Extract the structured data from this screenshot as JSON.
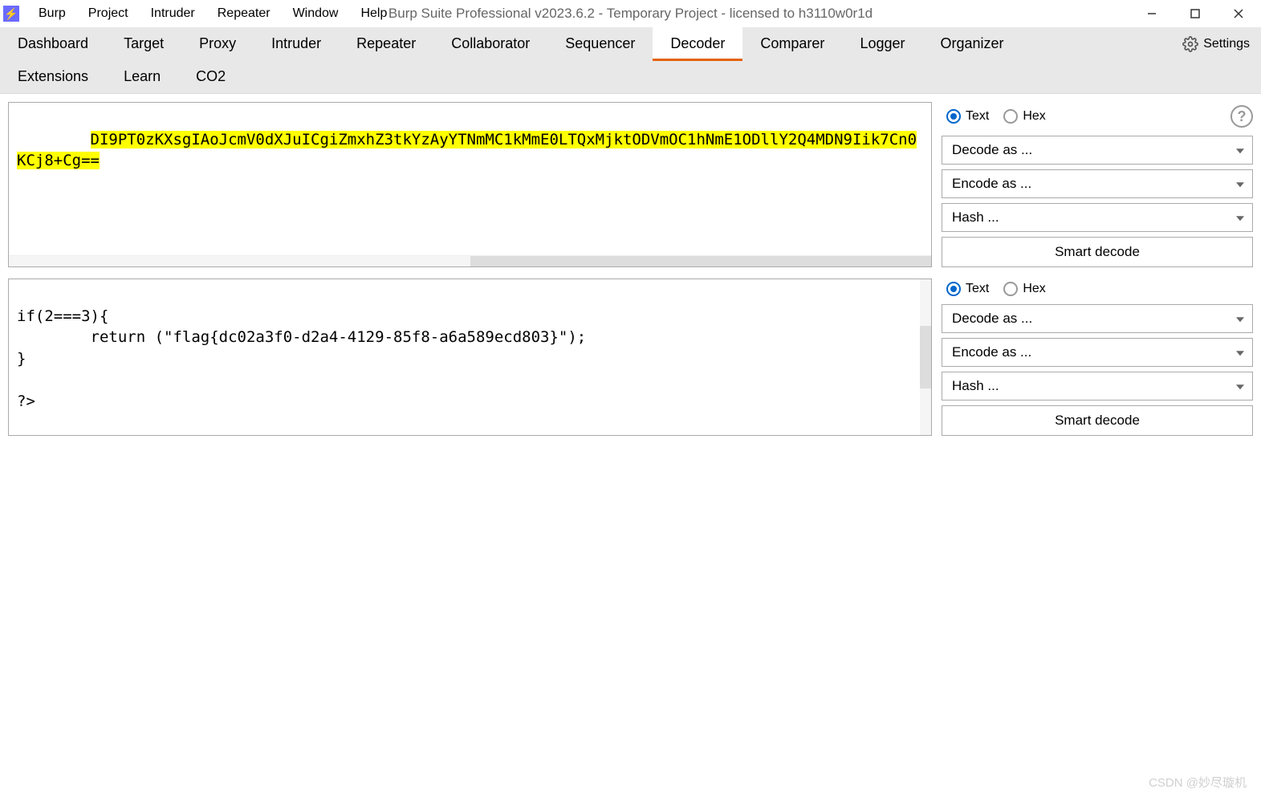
{
  "titlebar": {
    "app_icon_glyph": "⚡",
    "menus": [
      "Burp",
      "Project",
      "Intruder",
      "Repeater",
      "Window",
      "Help"
    ],
    "title": "Burp Suite Professional v2023.6.2 - Temporary Project - licensed to h3110w0r1d"
  },
  "tabs": {
    "row1": [
      "Dashboard",
      "Target",
      "Proxy",
      "Intruder",
      "Repeater",
      "Collaborator",
      "Sequencer",
      "Decoder",
      "Comparer",
      "Logger",
      "Organizer"
    ],
    "row2": [
      "Extensions",
      "Learn",
      "CO2"
    ],
    "active": "Decoder",
    "settings_label": "Settings"
  },
  "decoder": {
    "panels": [
      {
        "content": "DI9PT0zKXsgIAoJcmV0dXJuICgiZmxhZ3tkYzAyYTNmMC1kMmE0LTQxMjktODVmOC1hNmE1ODllY2Q4MDN9Iik7Cn0KCj8+Cg==",
        "highlighted": true,
        "hscroll": true,
        "vscroll": false,
        "side": {
          "radio_text": "Text",
          "radio_hex": "Hex",
          "help": true,
          "decode_as": "Decode as ...",
          "encode_as": "Encode as ...",
          "hash": "Hash ...",
          "smart_decode": "Smart decode"
        }
      },
      {
        "content": "\nif(2===3){\n        return (\"flag{dc02a3f0-d2a4-4129-85f8-a6a589ecd803}\");\n}\n\n?>",
        "highlighted": false,
        "hscroll": false,
        "vscroll": true,
        "side": {
          "radio_text": "Text",
          "radio_hex": "Hex",
          "help": false,
          "decode_as": "Decode as ...",
          "encode_as": "Encode as ...",
          "hash": "Hash ...",
          "smart_decode": "Smart decode"
        }
      }
    ]
  },
  "watermark": "CSDN @妙尽璇机"
}
